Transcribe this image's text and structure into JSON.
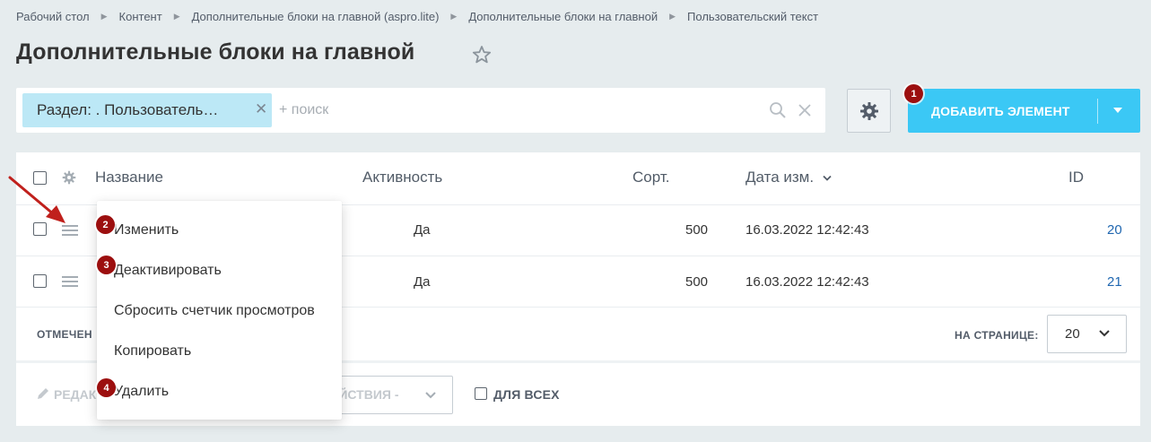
{
  "breadcrumb": [
    "Рабочий стол",
    "Контент",
    "Дополнительные блоки на главной (aspro.lite)",
    "Дополнительные блоки на главной",
    "Пользовательский текст"
  ],
  "page_title": "Дополнительные блоки на главной",
  "filter": {
    "tag_label": "Раздел: . Пользователь…",
    "search_placeholder": "+ поиск"
  },
  "toolbar": {
    "add_button_label": "ДОБАВИТЬ ЭЛЕМЕНТ"
  },
  "grid": {
    "columns": [
      "Название",
      "Активность",
      "Сорт.",
      "Дата изм.",
      "ID"
    ],
    "rows": [
      {
        "name": "",
        "active": "Да",
        "sort": "500",
        "date": "16.03.2022 12:42:43",
        "id": "20"
      },
      {
        "name": "",
        "active": "Да",
        "sort": "500",
        "date": "16.03.2022 12:42:43",
        "id": "21"
      }
    ],
    "selected_label": "ОТМЕЧЕН",
    "per_page_label": "НА СТРАНИЦЕ:",
    "per_page_value": "20"
  },
  "action_panel": {
    "edit_label": "РЕДАК",
    "actions_label": "ЕЙСТВИЯ -",
    "for_all_label": "ДЛЯ ВСЕХ"
  },
  "context_menu": {
    "items": [
      "Изменить",
      "Деактивировать",
      "Сбросить счетчик просмотров",
      "Копировать",
      "Удалить"
    ]
  },
  "annotations": {
    "badges": [
      "1",
      "2",
      "3",
      "4"
    ],
    "badge_color": "#9c0f0f",
    "arrow_color": "#c0201c"
  },
  "colors": {
    "accent": "#3bc8f5",
    "filter_tag": "#bce8f6",
    "link": "#2067b0"
  },
  "icons": [
    "star-icon",
    "search-icon",
    "clear-icon",
    "gear-icon",
    "chevron-down-icon",
    "hamburger-icon",
    "pencil-icon"
  ]
}
